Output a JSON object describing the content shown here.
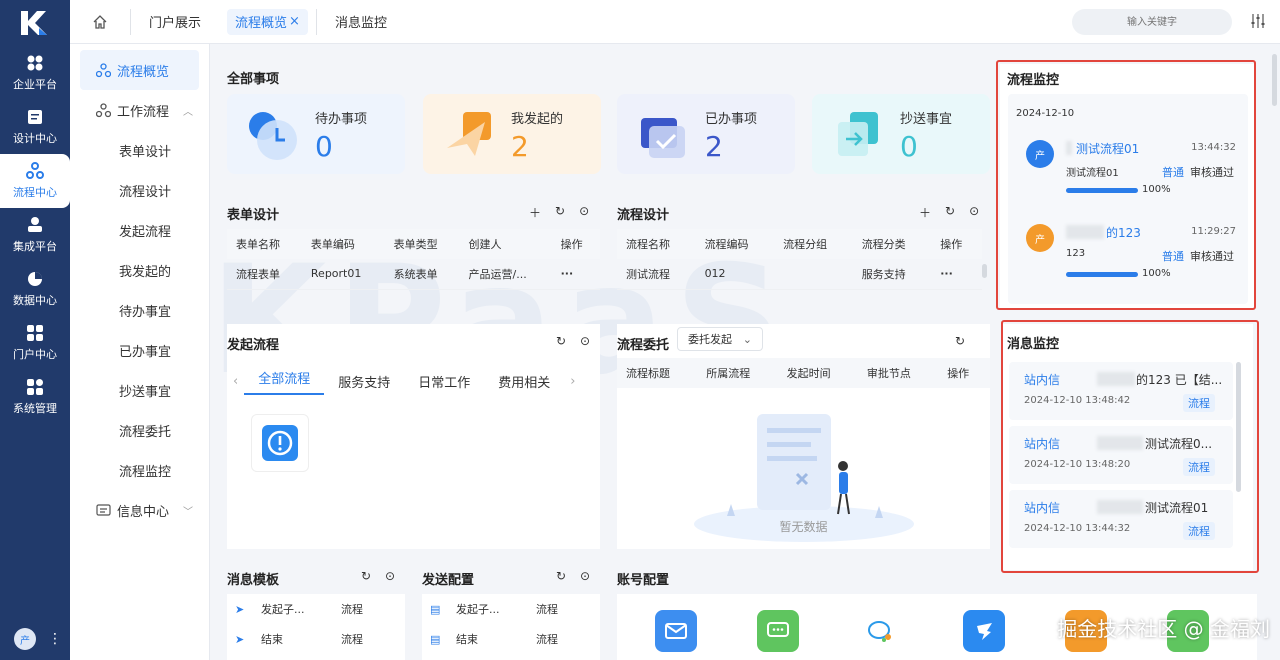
{
  "rail": {
    "items": [
      {
        "label": "企业平台",
        "icon": "grid-icon"
      },
      {
        "label": "设计中心",
        "icon": "document-icon"
      },
      {
        "label": "流程中心",
        "icon": "flow-icon"
      },
      {
        "label": "集成平台",
        "icon": "integration-icon"
      },
      {
        "label": "数据中心",
        "icon": "pie-chart-icon"
      },
      {
        "label": "门户中心",
        "icon": "portal-icon"
      },
      {
        "label": "系统管理",
        "icon": "system-icon"
      }
    ],
    "avatar": "产"
  },
  "topbar": {
    "tabs": [
      "门户展示",
      "流程概览",
      "消息监控"
    ],
    "active_tab_close": "×",
    "search_placeholder": "输入关键字"
  },
  "sidenav": {
    "overview": "流程概览",
    "workflow": "工作流程",
    "sub_items": [
      "表单设计",
      "流程设计",
      "发起流程",
      "我发起的",
      "待办事宜",
      "已办事宜",
      "抄送事宜",
      "流程委托",
      "流程监控"
    ],
    "info_center": "信息中心"
  },
  "main": {
    "all_items_title": "全部事项",
    "stats": [
      {
        "label": "待办事项",
        "value": "0",
        "color": "#2b7de9"
      },
      {
        "label": "我发起的",
        "value": "2",
        "color": "#f39a2b"
      },
      {
        "label": "已办事项",
        "value": "2",
        "color": "#3b57c9"
      },
      {
        "label": "抄送事宜",
        "value": "0",
        "color": "#3ec2d0"
      }
    ],
    "form_design": {
      "title": "表单设计",
      "columns": [
        "表单名称",
        "表单编码",
        "表单类型",
        "创建人",
        "操作"
      ],
      "rows": [
        [
          "流程表单",
          "Report01",
          "系统表单",
          "产品运营/..."
        ]
      ],
      "more": "···"
    },
    "flow_design": {
      "title": "流程设计",
      "columns": [
        "流程名称",
        "流程编码",
        "流程分组",
        "流程分类",
        "操作"
      ],
      "rows": [
        [
          "测试流程",
          "012",
          "",
          "服务支持"
        ]
      ],
      "more": "···"
    },
    "start_flow": {
      "title": "发起流程",
      "tabs": [
        "全部流程",
        "服务支持",
        "日常工作",
        "费用相关"
      ]
    },
    "delegation": {
      "title": "流程委托",
      "select": "委托发起",
      "columns": [
        "流程标题",
        "所属流程",
        "发起时间",
        "审批节点",
        "操作"
      ],
      "empty": "暂无数据"
    },
    "msg_template": {
      "title": "消息模板",
      "rows": [
        [
          "发起子...",
          "流程"
        ],
        [
          "结束",
          "流程"
        ]
      ]
    },
    "send_config": {
      "title": "发送配置",
      "rows": [
        [
          "发起子...",
          "流程"
        ],
        [
          "结束",
          "流程"
        ]
      ]
    },
    "account_config": {
      "title": "账号配置"
    },
    "flow_monitor": {
      "title": "流程监控",
      "date": "2024-12-10",
      "items": [
        {
          "avatar": "产",
          "name": "测试流程01",
          "time": "13:44:32",
          "sub": "测试流程01",
          "priority": "普通",
          "status": "审核通过",
          "progress": "100%",
          "progress_value": 1.0,
          "avatar_color": "#2b7de9"
        },
        {
          "avatar": "产",
          "name": "的123",
          "time": "11:29:27",
          "sub": "123",
          "priority": "普通",
          "status": "审核通过",
          "progress": "100%",
          "progress_value": 1.0,
          "avatar_color": "#f39a2b"
        }
      ]
    },
    "msg_monitor": {
      "title": "消息监控",
      "items": [
        {
          "type": "站内信",
          "text": "的123 已【结...",
          "time": "2024-12-10 13:48:42",
          "tag": "流程"
        },
        {
          "type": "站内信",
          "text": "测试流程0...",
          "time": "2024-12-10 13:48:20",
          "tag": "流程"
        },
        {
          "type": "站内信",
          "text": "测试流程01",
          "time": "2024-12-10 13:44:32",
          "tag": "流程"
        }
      ]
    }
  },
  "watermark_brand": "掘金技术社区 @ 金福刘"
}
